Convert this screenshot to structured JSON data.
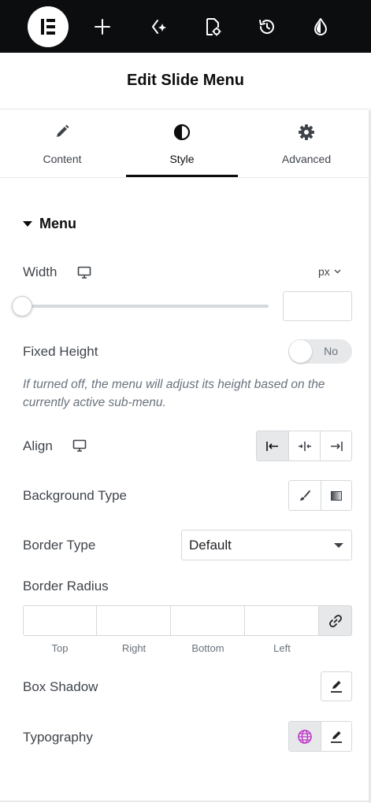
{
  "header": {
    "title": "Edit Slide Menu"
  },
  "tabs": [
    {
      "label": "Content",
      "icon": "pencil-icon"
    },
    {
      "label": "Style",
      "icon": "half-circle-icon"
    },
    {
      "label": "Advanced",
      "icon": "gear-icon"
    }
  ],
  "section": {
    "title": "Menu"
  },
  "width": {
    "label": "Width",
    "unit": "px",
    "value": ""
  },
  "fixed_height": {
    "label": "Fixed Height",
    "toggle_text": "No",
    "help": "If turned off, the menu will adjust its height based on the currently active sub-menu."
  },
  "align": {
    "label": "Align"
  },
  "background_type": {
    "label": "Background Type"
  },
  "border_type": {
    "label": "Border Type",
    "value": "Default"
  },
  "border_radius": {
    "label": "Border Radius",
    "fields": [
      "Top",
      "Right",
      "Bottom",
      "Left"
    ]
  },
  "box_shadow": {
    "label": "Box Shadow"
  },
  "typography": {
    "label": "Typography"
  },
  "colors": {
    "topbar": "#0c0d0e",
    "globe": "#c036c8"
  }
}
